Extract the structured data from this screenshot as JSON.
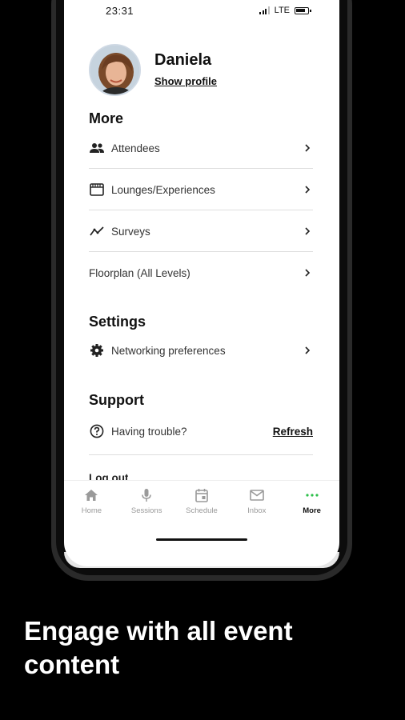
{
  "status_bar": {
    "time": "23:31",
    "network": "LTE"
  },
  "profile": {
    "name": "Daniela",
    "link_label": "Show profile"
  },
  "more": {
    "title": "More",
    "items": [
      {
        "label": "Attendees",
        "icon": "people-icon"
      },
      {
        "label": "Lounges/Experiences",
        "icon": "storefront-icon"
      },
      {
        "label": "Surveys",
        "icon": "trending-icon"
      },
      {
        "label": "Floorplan (All Levels)",
        "icon": ""
      }
    ]
  },
  "settings": {
    "title": "Settings",
    "items": [
      {
        "label": "Networking preferences",
        "icon": "gear-icon"
      }
    ]
  },
  "support": {
    "title": "Support",
    "trouble_label": "Having trouble?",
    "refresh_label": "Refresh"
  },
  "logout_label": "Log out",
  "bottom_nav": [
    {
      "label": "Home",
      "icon": "home-icon",
      "active": false
    },
    {
      "label": "Sessions",
      "icon": "microphone-icon",
      "active": false
    },
    {
      "label": "Schedule",
      "icon": "calendar-icon",
      "active": false
    },
    {
      "label": "Inbox",
      "icon": "mail-icon",
      "active": false
    },
    {
      "label": "More",
      "icon": "more-dots-icon",
      "active": true
    }
  ],
  "colors": {
    "active_nav_accent": "#2cbf4a",
    "inactive_nav": "#9a9a9a",
    "background": "#000000"
  },
  "tagline": "Engage with all event content"
}
